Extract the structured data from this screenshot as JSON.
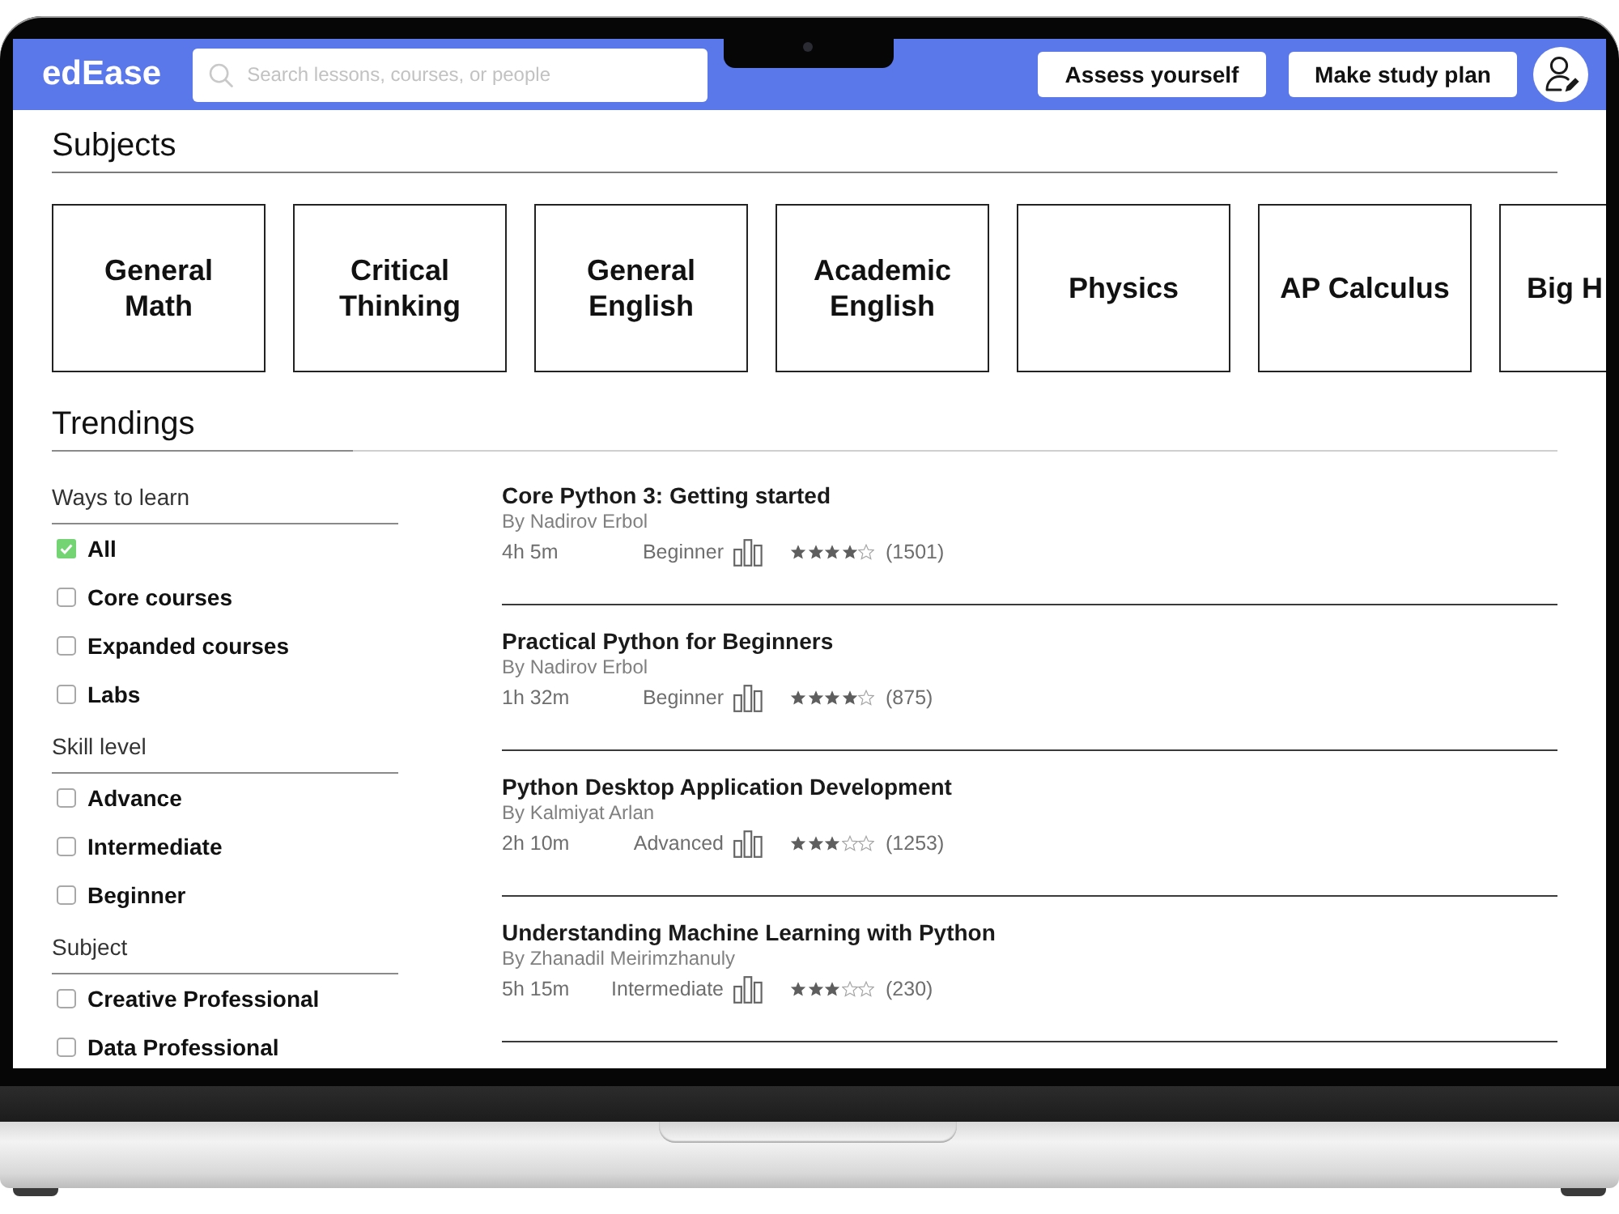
{
  "header": {
    "logo": "edEase",
    "search": {
      "placeholder": "Search lessons, courses, or people"
    },
    "buttons": [
      "Assess yourself",
      "Make study plan"
    ]
  },
  "subjects": {
    "title": "Subjects",
    "cards": [
      "General Math",
      "Critical Thinking",
      "General English",
      "Academic English",
      "Physics",
      "AP Calculus",
      "Big H"
    ]
  },
  "trendings": {
    "title": "Trendings",
    "filters": [
      {
        "heading": "Ways to learn",
        "options": [
          {
            "label": "All",
            "checked": true
          },
          {
            "label": "Core courses",
            "checked": false
          },
          {
            "label": "Expanded courses",
            "checked": false
          },
          {
            "label": "Labs",
            "checked": false
          }
        ]
      },
      {
        "heading": "Skill level",
        "options": [
          {
            "label": "Advance",
            "checked": false
          },
          {
            "label": "Intermediate",
            "checked": false
          },
          {
            "label": "Beginner",
            "checked": false
          }
        ]
      },
      {
        "heading": "Subject",
        "options": [
          {
            "label": "Creative Professional",
            "checked": false
          },
          {
            "label": "Data Professional",
            "checked": false
          }
        ]
      }
    ],
    "courses": [
      {
        "title": "Core Python 3: Getting started",
        "author": "By Nadirov Erbol",
        "duration": "4h 5m",
        "level": "Beginner",
        "stars": 4,
        "reviews": "(1501)"
      },
      {
        "title": "Practical Python for Beginners",
        "author": "By Nadirov Erbol",
        "duration": "1h 32m",
        "level": "Beginner",
        "stars": 4,
        "reviews": "(875)"
      },
      {
        "title": "Python Desktop Application Development",
        "author": "By Kalmiyat Arlan",
        "duration": "2h 10m",
        "level": "Advanced",
        "stars": 3,
        "reviews": "(1253)"
      },
      {
        "title": "Understanding Machine Learning with Python",
        "author": "By Zhanadil Meirimzhanuly",
        "duration": "5h 15m",
        "level": "Intermediate",
        "stars": 3,
        "reviews": "(230)"
      }
    ]
  }
}
